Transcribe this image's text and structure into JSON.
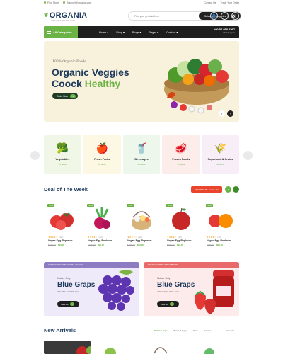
{
  "topbar": {
    "address": "Find Store",
    "email": "Support@organia.com",
    "contact": "Contact Us",
    "track": "Track Your Order"
  },
  "header": {
    "logo_name": "ORGANIA",
    "logo_tag": "ORGANIC PRODUCTS",
    "search_placeholder": "Find your product here",
    "category_select": "Select a Categories",
    "icons": [
      "user-icon",
      "heart-icon",
      "cart-icon"
    ]
  },
  "nav": {
    "all_categories": "All Categories",
    "items": [
      "Home",
      "Shop",
      "Blogs",
      "Pages",
      "Contact"
    ],
    "active": "Home",
    "phone": "+90 57 058 4567",
    "phone_label": "24/7 Support"
  },
  "hero": {
    "script": "100% Organic Foods",
    "title_line1": "Organic Veggies",
    "title_line2_a": "Coock ",
    "title_line2_b": "Healthy",
    "button": "Order Now"
  },
  "categories": [
    {
      "name": "Vegetables",
      "count": "35 Items",
      "bg": "#f1f7e7",
      "icon": "🥦"
    },
    {
      "name": "Fresh Fruits",
      "count": "35 Items",
      "bg": "#fdf8e4",
      "icon": "🍎"
    },
    {
      "name": "Beverages",
      "count": "35 Items",
      "bg": "#eef7ec",
      "icon": "🥤"
    },
    {
      "name": "Frozen Foods",
      "count": "35 Items",
      "bg": "#fcecea",
      "icon": "🥩"
    },
    {
      "name": "Superfood & Grains",
      "count": "35 Items",
      "bg": "#f7eef8",
      "icon": "🌾"
    }
  ],
  "deal": {
    "title": "Deal of The Week",
    "countdown": "OFFER IN 26 : 14 : 19 : 04",
    "products": [
      {
        "badge": "-15%",
        "name": "Vegan Egg Replacer",
        "old": "$180.00",
        "price": "$99.00"
      },
      {
        "badge": "-15%",
        "name": "Vegan Egg Replacer",
        "old": "$180.00",
        "price": "$99.00"
      },
      {
        "badge": "-15%",
        "name": "Vegan Egg Replacer",
        "old": "$180.00",
        "price": "$99.00"
      },
      {
        "badge": "-15%",
        "name": "Vegan Egg Replacer",
        "old": "$180.00",
        "price": "$99.00"
      },
      {
        "badge": "-15%",
        "name": "Vegan Egg Replacer",
        "old": "$180.00",
        "price": "$99.00"
      }
    ]
  },
  "promos": [
    {
      "bar": "FRESH FROM OUR FARMS - GRAPES",
      "small": "Nature Only",
      "title": "Blue Graps",
      "sub": "30% OFF IN JUNE JULY",
      "button": "View All",
      "bg": "#eeeaf9",
      "barbg": "#8e7cc3"
    },
    {
      "bar": "FRESH GOMERE STRAWBERRY",
      "small": "Nature Only",
      "title": "Blue Graps",
      "sub": "25% OFF IN JUNE JULY",
      "button": "View All",
      "bg": "#fdeaea",
      "barbg": "#e86a6a"
    }
  ],
  "arrivals": {
    "title": "New Arrivals",
    "tabs": [
      "Rakht & Sips",
      "Butter & Eggs",
      "Drink",
      "Frozen"
    ],
    "active_tab": "Rakht & Sips",
    "view_all": "View All"
  }
}
